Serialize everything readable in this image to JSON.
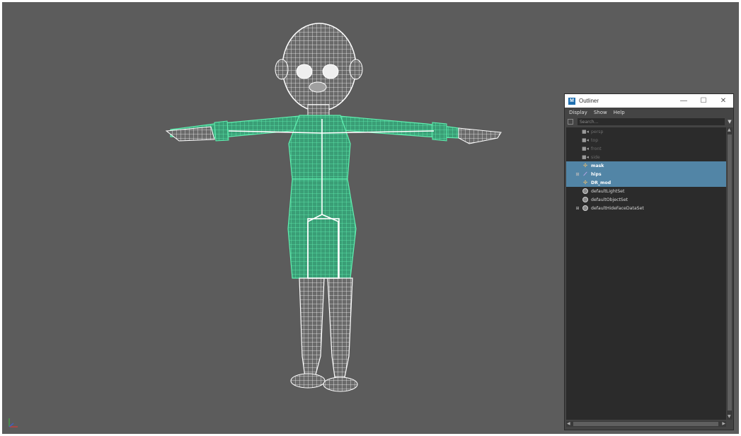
{
  "outliner": {
    "title": "Outliner",
    "logo": "M",
    "window_controls": {
      "minimize": "—",
      "maximize": "☐",
      "close": "✕"
    },
    "menu": [
      "Display",
      "Show",
      "Help"
    ],
    "search_placeholder": "Search...",
    "items": [
      {
        "label": "persp",
        "icon": "camera-icon",
        "state": "dim"
      },
      {
        "label": "top",
        "icon": "camera-icon",
        "state": "dim"
      },
      {
        "label": "front",
        "icon": "camera-icon",
        "state": "dim"
      },
      {
        "label": "side",
        "icon": "camera-icon",
        "state": "dim"
      },
      {
        "label": "mask",
        "icon": "transform-icon",
        "state": "selected"
      },
      {
        "label": "hips",
        "icon": "joint-icon",
        "state": "selected",
        "expandable": true
      },
      {
        "label": "DR_mod",
        "icon": "transform-icon",
        "state": "selected"
      },
      {
        "label": "defaultLightSet",
        "icon": "set-icon",
        "state": "normal"
      },
      {
        "label": "defaultObjectSet",
        "icon": "set-icon",
        "state": "normal"
      },
      {
        "label": "defaultHideFaceDataSet",
        "icon": "set-icon",
        "state": "normal",
        "expandable": true
      }
    ]
  },
  "colors": {
    "viewport_bg": "#5c5c5c",
    "selection": "#5285a6",
    "wireframe": "#ffffff",
    "selected_wireframe": "#46e0a0"
  }
}
